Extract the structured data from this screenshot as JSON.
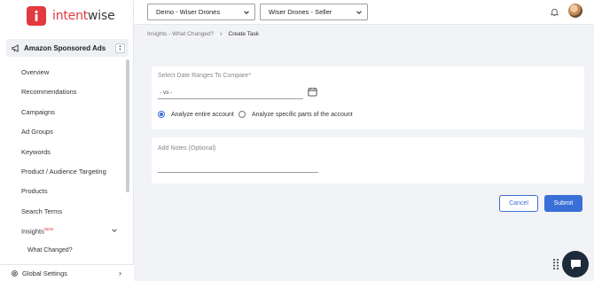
{
  "brand": {
    "logo_text_primary": "intent",
    "logo_text_secondary": "wise",
    "logo_color": "#e23a3f"
  },
  "sidebar": {
    "module": "Amazon Sponsored Ads",
    "items": [
      {
        "label": "Overview"
      },
      {
        "label": "Recommendations"
      },
      {
        "label": "Campaigns"
      },
      {
        "label": "Ad Groups"
      },
      {
        "label": "Keywords"
      },
      {
        "label": "Product / Audience Targeting"
      },
      {
        "label": "Products"
      },
      {
        "label": "Search Terms"
      },
      {
        "label": "Insights",
        "badge": "NEW"
      },
      {
        "label": "What Changed?"
      }
    ],
    "footer": "Global Settings"
  },
  "topbar": {
    "account_select": "Demo - Wiser Drones",
    "profile_select": "Wiser Drones - Seller"
  },
  "breadcrumb": {
    "parent": "Insights - What Changed?",
    "current": "Create Task"
  },
  "form": {
    "date_label": "Select Date Ranges To Compare*",
    "date_value": "- vs -",
    "radio_entire": "Analyze entire account",
    "radio_specific": "Analyze specific parts of the account",
    "notes_label": "Add Notes (Optional)",
    "cancel_label": "Cancel",
    "submit_label": "Submit"
  },
  "colors": {
    "accent": "#3b6fd8",
    "brand": "#e23a3f"
  }
}
